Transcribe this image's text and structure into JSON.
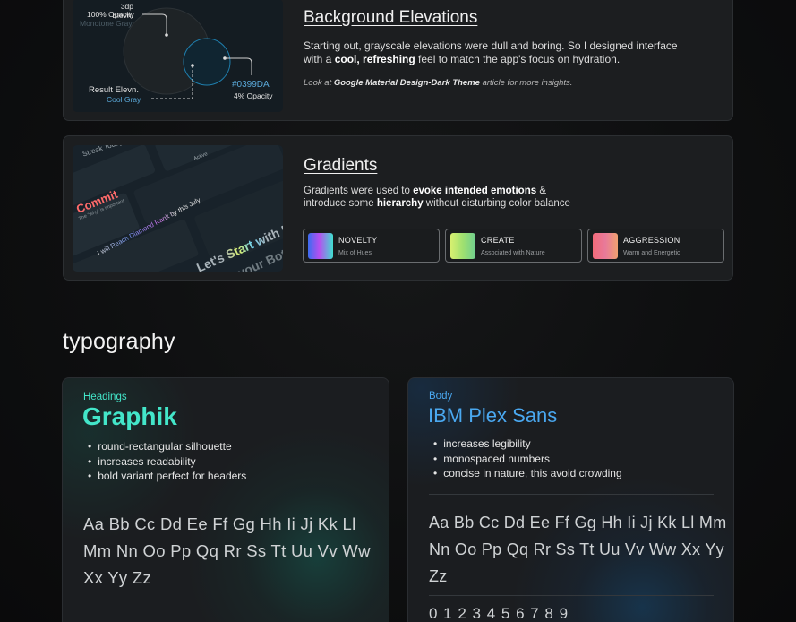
{
  "elevation": {
    "title": "Background Elevations",
    "desc_1": "Starting out, grayscale elevations were dull and boring. So I designed interface",
    "desc_2a": "with a ",
    "desc_2b": "cool, refreshing",
    "desc_2c": " feel to match the app's focus on hydration.",
    "note_a": "Look at ",
    "note_b": "Google Material Design-Dark Theme",
    "note_c": " article for more insights.",
    "diagram": {
      "top_label": "3dp Elevn.",
      "top_opacity": "100% Opacity",
      "top_color": "Monotone Gray",
      "result_label": "Result Elevn.",
      "result_color": "Cool Gray",
      "hex": "#0399DA",
      "hex_opacity": "4% Opacity"
    }
  },
  "gradients": {
    "title": "Gradients",
    "desc_1a": "Gradients were used to ",
    "desc_1b": "evoke intended emotions",
    "desc_1c": " &",
    "desc_2a": "introduce some ",
    "desc_2b": "hierarchy",
    "desc_2c": " without disturbing color balance",
    "preview": {
      "top_text": "Streak Today",
      "commit": "Commit",
      "commit_sub": "The \"why\" is important",
      "reach": "I will Reach Diamond Rank by this July",
      "active": "Active",
      "lets_start": "Let's Start with F",
      "your_bott": "your Bott"
    },
    "chips": [
      {
        "title": "NOVELTY",
        "sub": "Mix of Hues",
        "grad_from": "#3b6cf0",
        "grad_mid": "#b64ff0",
        "grad_to": "#40e0d0"
      },
      {
        "title": "CREATE",
        "sub": "Associated with Nature",
        "grad_from": "#d8f070",
        "grad_mid": "#9fe070",
        "grad_to": "#6fcf8f"
      },
      {
        "title": "AGGRESSION",
        "sub": "Warm and Energetic",
        "grad_from": "#f36b7a",
        "grad_mid": "#e87a9a",
        "grad_to": "#f0a070"
      }
    ]
  },
  "typography": {
    "section_title": "typography",
    "headings": {
      "label": "Headings",
      "font_name": "Graphik",
      "points": [
        "round-rectangular silhouette",
        "increases readability",
        "bold variant perfect for headers"
      ],
      "alpha_1": "Aa Bb Cc Dd Ee Ff Gg Hh Ii Jj Kk Ll",
      "alpha_2": "Mm Nn Oo Pp Qq Rr Ss Tt Uu Vv Ww",
      "alpha_3": "Xx Yy Zz",
      "accent": "#43e6c9"
    },
    "body": {
      "label": "Body",
      "font_name": "IBM Plex Sans",
      "points": [
        "increases legibility",
        "monospaced numbers",
        "concise in nature, this avoid crowding"
      ],
      "alpha_1": "Aa Bb Cc Dd Ee Ff Gg Hh Ii Jj Kk Ll Mm",
      "alpha_2": "Nn Oo Pp Qq Rr Ss Tt Uu Vv Ww Xx Yy",
      "alpha_3": "Zz",
      "numbers": "0 1 2 3 4 5 6 7 8 9",
      "accent": "#4aa8f0"
    }
  }
}
